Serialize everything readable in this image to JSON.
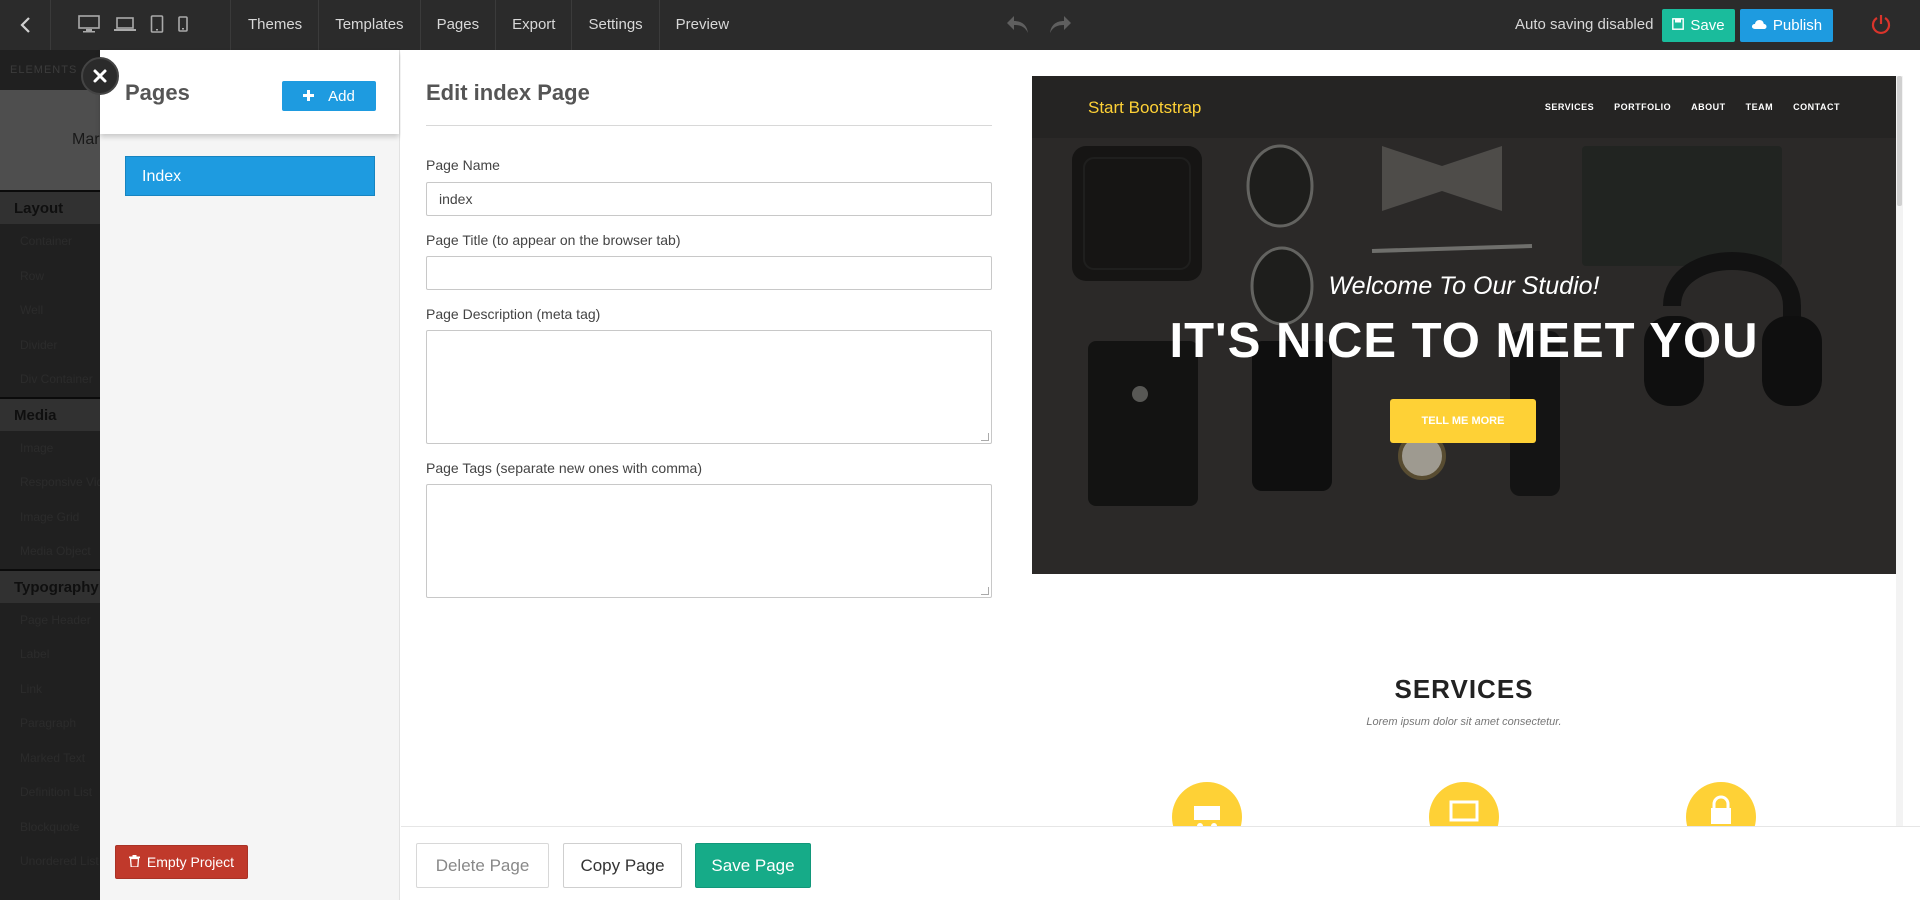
{
  "topbar": {
    "menu": [
      "Themes",
      "Templates",
      "Pages",
      "Export",
      "Settings",
      "Preview"
    ],
    "autosave": "Auto saving disabled",
    "save": "Save",
    "publish": "Publish"
  },
  "elements_sidebar": {
    "header": "ELEMENTS",
    "thumb_label": "Mar",
    "categories": [
      {
        "name": "Layout",
        "items": [
          "Container",
          "Row",
          "Well",
          "Divider",
          "Div Container"
        ]
      },
      {
        "name": "Media",
        "items": [
          "Image",
          "Responsive Vid",
          "Image Grid",
          "Media Object"
        ]
      },
      {
        "name": "Typography",
        "items": [
          "Page Header",
          "Label",
          "Link",
          "Paragraph",
          "Marked Text",
          "Definition List",
          "Blockquote",
          "Unordered List"
        ]
      }
    ]
  },
  "pages_panel": {
    "title": "Pages",
    "add": "Add",
    "pages": [
      "Index"
    ],
    "empty_project": "Empty Project"
  },
  "edit_form": {
    "title": "Edit index Page",
    "page_name_label": "Page Name",
    "page_name_value": "index",
    "page_title_label": "Page Title (to appear on the browser tab)",
    "page_title_value": "",
    "description_label": "Page Description (meta tag)",
    "tags_label": "Page Tags (separate new ones with comma)",
    "delete": "Delete Page",
    "copy": "Copy Page",
    "save": "Save Page"
  },
  "preview": {
    "brand": "Start Bootstrap",
    "nav": [
      "SERVICES",
      "PORTFOLIO",
      "ABOUT",
      "TEAM",
      "CONTACT"
    ],
    "hero_subheading": "Welcome To Our Studio!",
    "hero_heading": "IT'S NICE TO MEET YOU",
    "hero_button": "TELL ME MORE",
    "services_title": "SERVICES",
    "services_subtitle": "Lorem ipsum dolor sit amet consectetur."
  },
  "colors": {
    "topbar": "#2b2b2b",
    "accent_blue": "#1e9be0",
    "accent_green": "#1abc9c",
    "danger": "#c0392b",
    "brand_yellow": "#fed136"
  }
}
